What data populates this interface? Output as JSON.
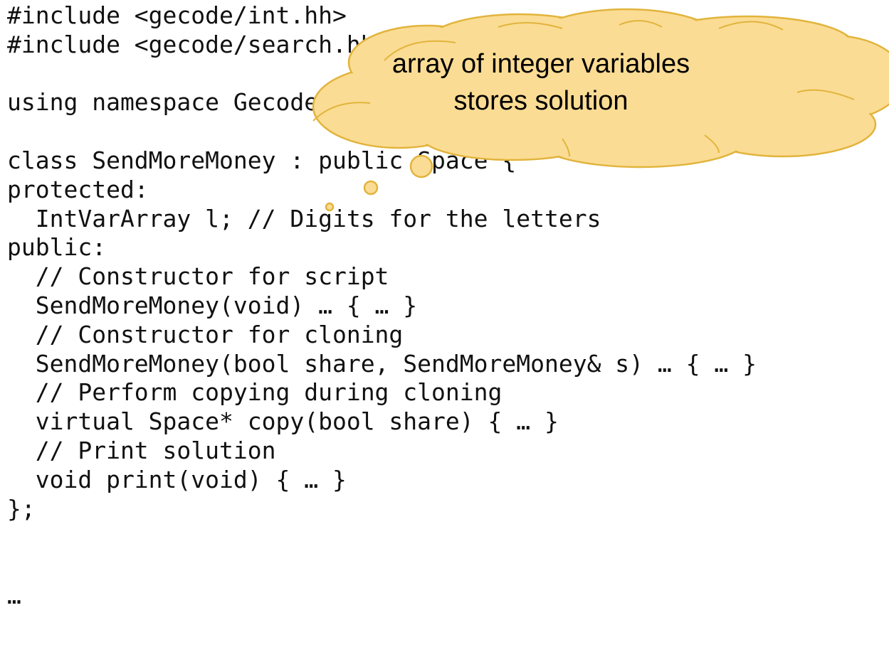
{
  "code": {
    "lines": [
      "#include <gecode/int.hh>",
      "#include <gecode/search.hh>",
      "",
      "using namespace Gecode;",
      "",
      "class SendMoreMoney : public Space {",
      "protected:",
      "  IntVarArray l; // Digits for the letters",
      "public:",
      "  // Constructor for script",
      "  SendMoreMoney(void) … { … }",
      "  // Constructor for cloning",
      "  SendMoreMoney(bool share, SendMoreMoney& s) … { … }",
      "  // Perform copying during cloning",
      "  virtual Space* copy(bool share) { … }",
      "  // Print solution",
      "  void print(void) { … }",
      "};",
      "",
      "",
      "…"
    ]
  },
  "callout": {
    "line1": "array of integer variables",
    "line2": "stores solution",
    "fill_color": "#fbdc94",
    "stroke_color": "#e1b43c"
  }
}
